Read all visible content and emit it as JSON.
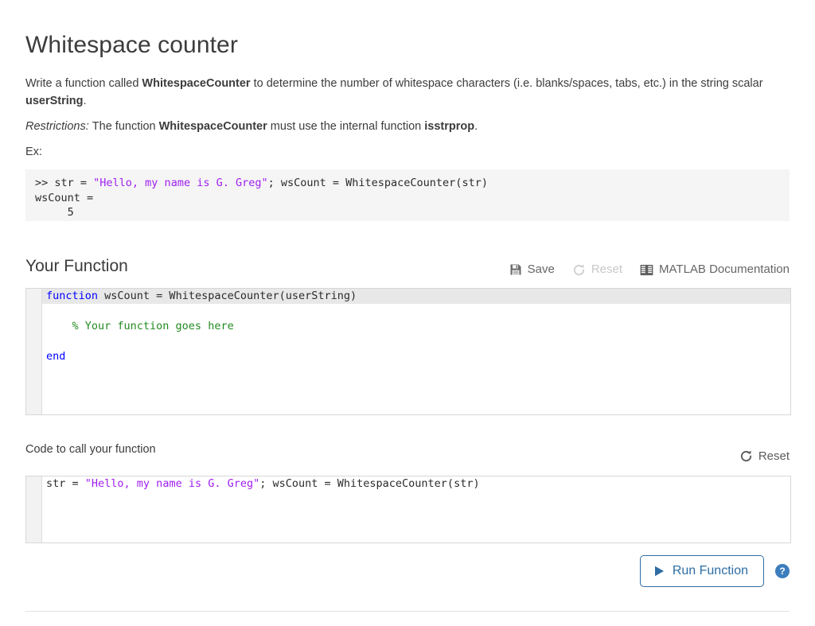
{
  "title": "Whitespace counter",
  "prompt": {
    "before_fn": "Write a function called ",
    "fn_name": "WhitespaceCounter",
    "middle": " to determine the number of whitespace characters (i.e. blanks/spaces, tabs, etc.) in the string scalar ",
    "arg_name": "userString",
    "after": "."
  },
  "restrictions": {
    "label": "Restrictions:",
    "text_before": "The function ",
    "fn_name": "WhitespaceCounter",
    "text_middle": " must use the internal function ",
    "internal_fn": "isstrprop",
    "text_after": "."
  },
  "example_label": "Ex:",
  "example_block": {
    "line1_prefix": ">> str = ",
    "line1_string": "\"Hello, my name is G. Greg\"",
    "line1_suffix": "; wsCount = WhitespaceCounter(str)",
    "line2": "wsCount =",
    "line3": "     5"
  },
  "your_function": {
    "heading": "Your Function",
    "toolbar": {
      "save_label": "Save",
      "save_icon": "floppy-disk-icon",
      "reset_label": "Reset",
      "reset_icon": "circular-arrow-icon",
      "reset_disabled": true,
      "docs_label": "MATLAB Documentation",
      "docs_icon": "book-icon"
    },
    "code_lines": [
      {
        "n": "1",
        "active": true,
        "segments": [
          {
            "t": "function",
            "c": "kw"
          },
          {
            "t": " wsCount = WhitespaceCounter(userString)",
            "c": ""
          }
        ]
      },
      {
        "n": "2",
        "active": false,
        "segments": [
          {
            "t": "",
            "c": ""
          }
        ]
      },
      {
        "n": "3",
        "active": false,
        "segments": [
          {
            "t": "    % Your function goes here",
            "c": "cmt"
          }
        ]
      },
      {
        "n": "4",
        "active": false,
        "segments": [
          {
            "t": "",
            "c": ""
          }
        ]
      },
      {
        "n": "5",
        "active": false,
        "segments": [
          {
            "t": "end",
            "c": "kw"
          }
        ]
      }
    ]
  },
  "call_code": {
    "heading": "Code to call your function",
    "reset_label": "Reset",
    "reset_icon": "circular-arrow-icon",
    "code_lines": [
      {
        "n": "1",
        "active": false,
        "segments": [
          {
            "t": "str = ",
            "c": ""
          },
          {
            "t": "\"Hello, my name is G. Greg\"",
            "c": "st"
          },
          {
            "t": "; wsCount = WhitespaceCounter(str)",
            "c": ""
          }
        ]
      }
    ]
  },
  "run": {
    "label": "Run Function",
    "play_icon": "play-triangle-icon",
    "help_icon": "question-mark-icon",
    "help_glyph": "?"
  },
  "colors": {
    "accent_blue": "#2e6da4",
    "help_blue": "#3d7ebd",
    "keyword_blue": "#0000ff",
    "string_purple": "#a020f0",
    "comment_green": "#228b22",
    "code_bg": "#f5f5f5",
    "active_line": "#e8e8e8",
    "text": "#3c3c3c"
  }
}
